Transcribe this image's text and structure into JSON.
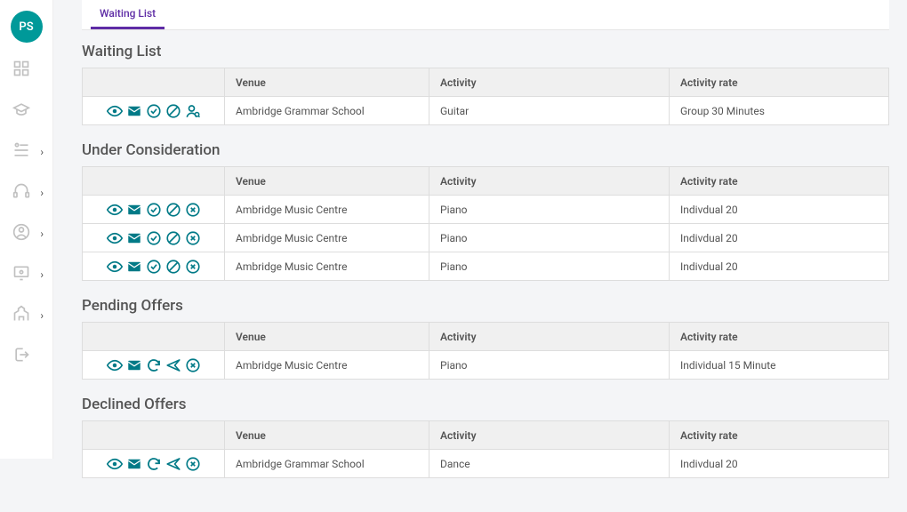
{
  "avatar": "PS",
  "active_tab": "Waiting List",
  "columns": {
    "venue": "Venue",
    "activity": "Activity",
    "rate": "Activity rate"
  },
  "sections": [
    {
      "title": "Waiting List",
      "actionSet": "waiting",
      "rows": [
        {
          "venue": "Ambridge Grammar School",
          "activity": "Guitar",
          "rate": "Group 30 Minutes"
        }
      ]
    },
    {
      "title": "Under Consideration",
      "actionSet": "consideration",
      "rows": [
        {
          "venue": "Ambridge Music Centre",
          "activity": "Piano",
          "rate": "Indivdual 20"
        },
        {
          "venue": "Ambridge Music Centre",
          "activity": "Piano",
          "rate": "Indivdual 20"
        },
        {
          "venue": "Ambridge Music Centre",
          "activity": "Piano",
          "rate": "Indivdual 20"
        }
      ]
    },
    {
      "title": "Pending Offers",
      "actionSet": "pending",
      "rows": [
        {
          "venue": "Ambridge Music Centre",
          "activity": "Piano",
          "rate": "Individual 15 Minute"
        }
      ]
    },
    {
      "title": "Declined Offers",
      "actionSet": "declined",
      "rows": [
        {
          "venue": "Ambridge Grammar School",
          "activity": "Dance",
          "rate": "Indivdual 20"
        }
      ]
    }
  ]
}
